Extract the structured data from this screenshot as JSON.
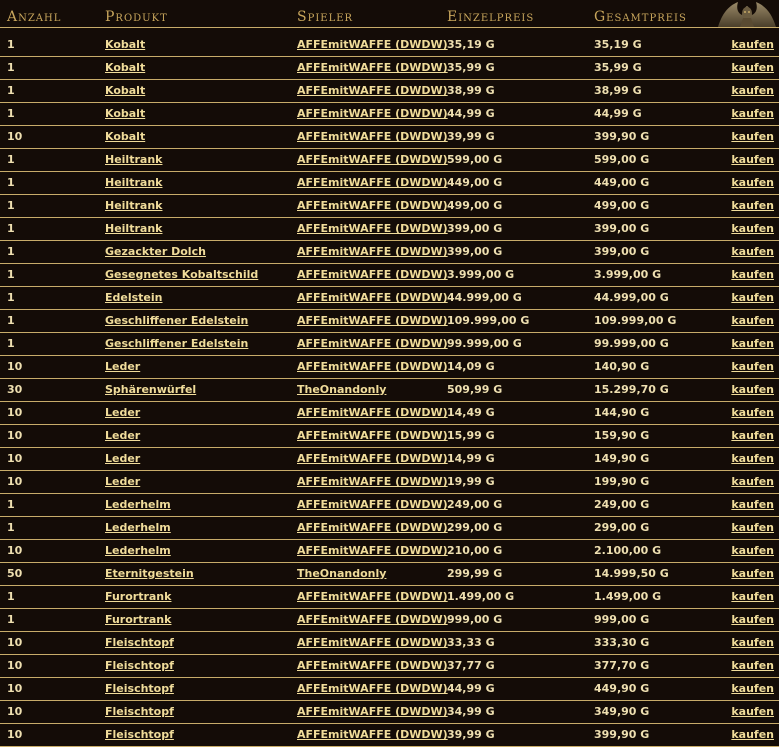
{
  "headers": {
    "qty": "Anzahl",
    "product": "Produkt",
    "player": "Spieler",
    "unit_price": "Einzelpreis",
    "total_price": "Gesamtpreis"
  },
  "rows": [
    {
      "qty": "1",
      "product": "Kobalt",
      "player": "AFFEmitWAFFE (DWDW)",
      "unit": "35,19 G",
      "total": "35,19 G",
      "action": "kaufen"
    },
    {
      "qty": "1",
      "product": "Kobalt",
      "player": "AFFEmitWAFFE (DWDW)",
      "unit": "35,99 G",
      "total": "35,99 G",
      "action": "kaufen"
    },
    {
      "qty": "1",
      "product": "Kobalt",
      "player": "AFFEmitWAFFE (DWDW)",
      "unit": "38,99 G",
      "total": "38,99 G",
      "action": "kaufen"
    },
    {
      "qty": "1",
      "product": "Kobalt",
      "player": "AFFEmitWAFFE (DWDW)",
      "unit": "44,99 G",
      "total": "44,99 G",
      "action": "kaufen"
    },
    {
      "qty": "10",
      "product": "Kobalt",
      "player": "AFFEmitWAFFE (DWDW)",
      "unit": "39,99 G",
      "total": "399,90 G",
      "action": "kaufen"
    },
    {
      "qty": "1",
      "product": "Heiltrank",
      "player": "AFFEmitWAFFE (DWDW)",
      "unit": "599,00 G",
      "total": "599,00 G",
      "action": "kaufen"
    },
    {
      "qty": "1",
      "product": "Heiltrank",
      "player": "AFFEmitWAFFE (DWDW)",
      "unit": "449,00 G",
      "total": "449,00 G",
      "action": "kaufen"
    },
    {
      "qty": "1",
      "product": "Heiltrank",
      "player": "AFFEmitWAFFE (DWDW)",
      "unit": "499,00 G",
      "total": "499,00 G",
      "action": "kaufen"
    },
    {
      "qty": "1",
      "product": "Heiltrank",
      "player": "AFFEmitWAFFE (DWDW)",
      "unit": "399,00 G",
      "total": "399,00 G",
      "action": "kaufen"
    },
    {
      "qty": "1",
      "product": "Gezackter Dolch",
      "player": "AFFEmitWAFFE (DWDW)",
      "unit": "399,00 G",
      "total": "399,00 G",
      "action": "kaufen"
    },
    {
      "qty": "1",
      "product": "Gesegnetes Kobaltschild",
      "player": "AFFEmitWAFFE (DWDW)",
      "unit": "3.999,00 G",
      "total": "3.999,00 G",
      "action": "kaufen"
    },
    {
      "qty": "1",
      "product": "Edelstein",
      "player": "AFFEmitWAFFE (DWDW)",
      "unit": "44.999,00 G",
      "total": "44.999,00 G",
      "action": "kaufen"
    },
    {
      "qty": "1",
      "product": "Geschliffener Edelstein",
      "player": "AFFEmitWAFFE (DWDW)",
      "unit": "109.999,00 G",
      "total": "109.999,00 G",
      "action": "kaufen"
    },
    {
      "qty": "1",
      "product": "Geschliffener Edelstein",
      "player": "AFFEmitWAFFE (DWDW)",
      "unit": "99.999,00 G",
      "total": "99.999,00 G",
      "action": "kaufen"
    },
    {
      "qty": "10",
      "product": "Leder",
      "player": "AFFEmitWAFFE (DWDW)",
      "unit": "14,09 G",
      "total": "140,90 G",
      "action": "kaufen"
    },
    {
      "qty": "30",
      "product": "Sphärenwürfel",
      "player": "TheOnandonly",
      "unit": "509,99 G",
      "total": "15.299,70 G",
      "action": "kaufen"
    },
    {
      "qty": "10",
      "product": "Leder",
      "player": "AFFEmitWAFFE (DWDW)",
      "unit": "14,49 G",
      "total": "144,90 G",
      "action": "kaufen"
    },
    {
      "qty": "10",
      "product": "Leder",
      "player": "AFFEmitWAFFE (DWDW)",
      "unit": "15,99 G",
      "total": "159,90 G",
      "action": "kaufen"
    },
    {
      "qty": "10",
      "product": "Leder",
      "player": "AFFEmitWAFFE (DWDW)",
      "unit": "14,99 G",
      "total": "149,90 G",
      "action": "kaufen"
    },
    {
      "qty": "10",
      "product": "Leder",
      "player": "AFFEmitWAFFE (DWDW)",
      "unit": "19,99 G",
      "total": "199,90 G",
      "action": "kaufen"
    },
    {
      "qty": "1",
      "product": "Lederhelm",
      "player": "AFFEmitWAFFE (DWDW)",
      "unit": "249,00 G",
      "total": "249,00 G",
      "action": "kaufen"
    },
    {
      "qty": "1",
      "product": "Lederhelm",
      "player": "AFFEmitWAFFE (DWDW)",
      "unit": "299,00 G",
      "total": "299,00 G",
      "action": "kaufen"
    },
    {
      "qty": "10",
      "product": "Lederhelm",
      "player": "AFFEmitWAFFE (DWDW)",
      "unit": "210,00 G",
      "total": "2.100,00 G",
      "action": "kaufen"
    },
    {
      "qty": "50",
      "product": "Eternitgestein",
      "player": "TheOnandonly",
      "unit": "299,99 G",
      "total": "14.999,50 G",
      "action": "kaufen"
    },
    {
      "qty": "1",
      "product": "Furortrank",
      "player": "AFFEmitWAFFE (DWDW)",
      "unit": "1.499,00 G",
      "total": "1.499,00 G",
      "action": "kaufen"
    },
    {
      "qty": "1",
      "product": "Furortrank",
      "player": "AFFEmitWAFFE (DWDW)",
      "unit": "999,00 G",
      "total": "999,00 G",
      "action": "kaufen"
    },
    {
      "qty": "10",
      "product": "Fleischtopf",
      "player": "AFFEmitWAFFE (DWDW)",
      "unit": "33,33 G",
      "total": "333,30 G",
      "action": "kaufen"
    },
    {
      "qty": "10",
      "product": "Fleischtopf",
      "player": "AFFEmitWAFFE (DWDW)",
      "unit": "37,77 G",
      "total": "377,70 G",
      "action": "kaufen"
    },
    {
      "qty": "10",
      "product": "Fleischtopf",
      "player": "AFFEmitWAFFE (DWDW)",
      "unit": "44,99 G",
      "total": "449,90 G",
      "action": "kaufen"
    },
    {
      "qty": "10",
      "product": "Fleischtopf",
      "player": "AFFEmitWAFFE (DWDW)",
      "unit": "34,99 G",
      "total": "349,90 G",
      "action": "kaufen"
    },
    {
      "qty": "10",
      "product": "Fleischtopf",
      "player": "AFFEmitWAFFE (DWDW)",
      "unit": "39,99 G",
      "total": "399,90 G",
      "action": "kaufen"
    }
  ]
}
